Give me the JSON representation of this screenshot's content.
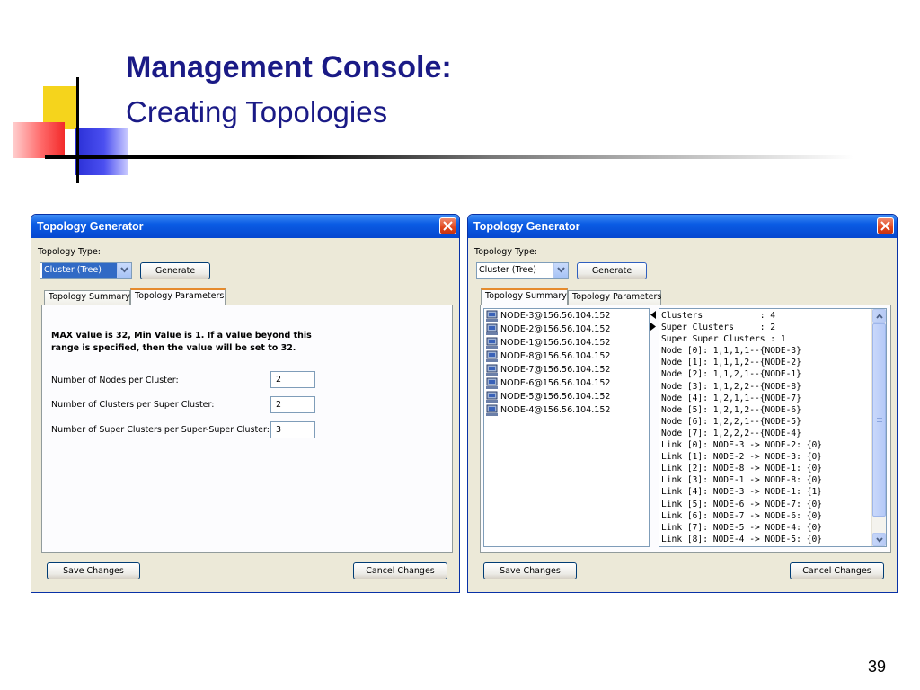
{
  "slide": {
    "title": "Management Console:",
    "subtitle": "Creating Topologies",
    "page_number": "39"
  },
  "left_window": {
    "title": "Topology Generator",
    "topology_type_label": "Topology Type:",
    "topology_type_value": "Cluster (Tree)",
    "generate_label": "Generate",
    "tabs": [
      {
        "label": "Topology Summary",
        "active": false
      },
      {
        "label": "Topology Parameters",
        "active": true
      }
    ],
    "info_text": "MAX value is 32, Min Value is 1. If a value beyond this range is specified, then the value will be set to 32.",
    "params": [
      {
        "label": "Number of Nodes per Cluster:",
        "value": "2"
      },
      {
        "label": "Number of Clusters per Super Cluster:",
        "value": "2"
      },
      {
        "label": "Number of Super Clusters per Super-Super Cluster:",
        "value": "3"
      }
    ],
    "save_label": "Save Changes",
    "cancel_label": "Cancel Changes"
  },
  "right_window": {
    "title": "Topology Generator",
    "topology_type_label": "Topology Type:",
    "topology_type_value": "Cluster (Tree)",
    "generate_label": "Generate",
    "tabs": [
      {
        "label": "Topology Summary",
        "active": true
      },
      {
        "label": "Topology Parameters",
        "active": false
      }
    ],
    "nodes": [
      "NODE-3@156.56.104.152",
      "NODE-2@156.56.104.152",
      "NODE-1@156.56.104.152",
      "NODE-8@156.56.104.152",
      "NODE-7@156.56.104.152",
      "NODE-6@156.56.104.152",
      "NODE-5@156.56.104.152",
      "NODE-4@156.56.104.152"
    ],
    "summary_lines": [
      "Clusters           : 4",
      "Super Clusters     : 2",
      "Super Super Clusters : 1",
      "Node [0]: 1,1,1,1--{NODE-3}",
      "Node [1]: 1,1,1,2--{NODE-2}",
      "Node [2]: 1,1,2,1--{NODE-1}",
      "Node [3]: 1,1,2,2--{NODE-8}",
      "Node [4]: 1,2,1,1--{NODE-7}",
      "Node [5]: 1,2,1,2--{NODE-6}",
      "Node [6]: 1,2,2,1--{NODE-5}",
      "Node [7]: 1,2,2,2--{NODE-4}",
      "Link [0]: NODE-3 -> NODE-2: {0}",
      "Link [1]: NODE-2 -> NODE-3: {0}",
      "Link [2]: NODE-8 -> NODE-1: {0}",
      "Link [3]: NODE-1 -> NODE-8: {0}",
      "Link [4]: NODE-3 -> NODE-1: {1}",
      "Link [5]: NODE-6 -> NODE-7: {0}",
      "Link [6]: NODE-7 -> NODE-6: {0}",
      "Link [7]: NODE-5 -> NODE-4: {0}",
      "Link [8]: NODE-4 -> NODE-5: {0}"
    ],
    "save_label": "Save Changes",
    "cancel_label": "Cancel Changes"
  },
  "icons": {
    "close": "close-icon",
    "dropdown": "chevron-down-icon",
    "node": "computer-node-icon",
    "splitter_left": "arrow-left-icon",
    "splitter_right": "arrow-right-icon",
    "scroll_up": "chevron-up-icon",
    "scroll_down": "chevron-down-icon"
  },
  "colors": {
    "title_blue": "#1a1a86",
    "titlebar_blue": "#0b5ce4",
    "window_bg": "#ece9d8",
    "tab_active_accent": "#e68b2c",
    "selection_blue": "#316ac5"
  }
}
